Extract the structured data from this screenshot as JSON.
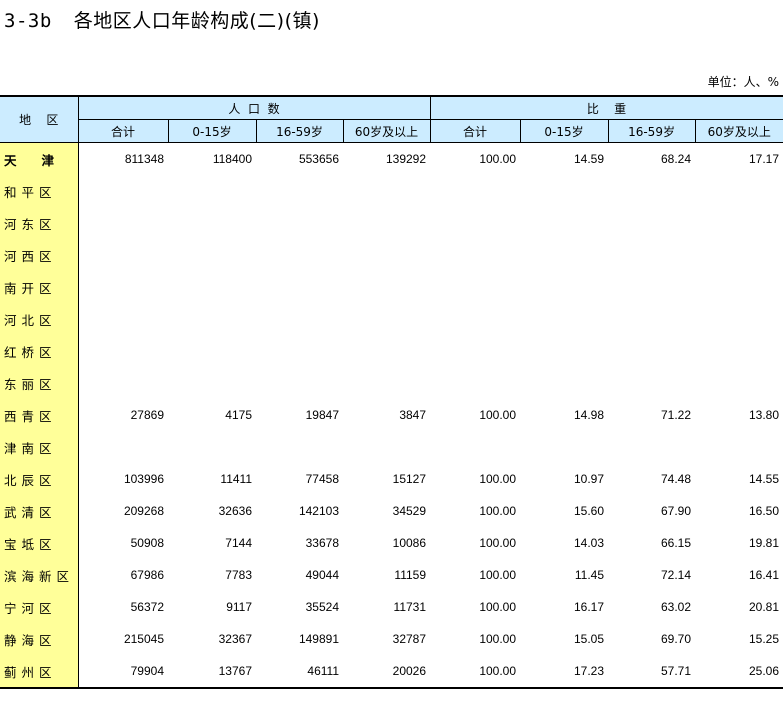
{
  "title": {
    "code": "3-3b",
    "text": "各地区人口年龄构成(二)(镇)"
  },
  "unit": "单位：人、%",
  "header": {
    "region": "地    区",
    "group_population": "人  口  数",
    "group_ratio": "比    重",
    "columns": [
      "合计",
      "0-15岁",
      "16-59岁",
      "60岁及以上",
      "合计",
      "0-15岁",
      "16-59岁",
      "60岁及以上"
    ]
  },
  "rows": [
    {
      "region": "天津",
      "values": [
        "811348",
        "118400",
        "553656",
        "139292",
        "100.00",
        "14.59",
        "68.24",
        "17.17"
      ]
    },
    {
      "region": "和平区",
      "values": [
        "",
        "",
        "",
        "",
        "",
        "",
        "",
        ""
      ]
    },
    {
      "region": "河东区",
      "values": [
        "",
        "",
        "",
        "",
        "",
        "",
        "",
        ""
      ]
    },
    {
      "region": "河西区",
      "values": [
        "",
        "",
        "",
        "",
        "",
        "",
        "",
        ""
      ]
    },
    {
      "region": "南开区",
      "values": [
        "",
        "",
        "",
        "",
        "",
        "",
        "",
        ""
      ]
    },
    {
      "region": "河北区",
      "values": [
        "",
        "",
        "",
        "",
        "",
        "",
        "",
        ""
      ]
    },
    {
      "region": "红桥区",
      "values": [
        "",
        "",
        "",
        "",
        "",
        "",
        "",
        ""
      ]
    },
    {
      "region": "东丽区",
      "values": [
        "",
        "",
        "",
        "",
        "",
        "",
        "",
        ""
      ]
    },
    {
      "region": "西青区",
      "values": [
        "27869",
        "4175",
        "19847",
        "3847",
        "100.00",
        "14.98",
        "71.22",
        "13.80"
      ]
    },
    {
      "region": "津南区",
      "values": [
        "",
        "",
        "",
        "",
        "",
        "",
        "",
        ""
      ]
    },
    {
      "region": "北辰区",
      "values": [
        "103996",
        "11411",
        "77458",
        "15127",
        "100.00",
        "10.97",
        "74.48",
        "14.55"
      ]
    },
    {
      "region": "武清区",
      "values": [
        "209268",
        "32636",
        "142103",
        "34529",
        "100.00",
        "15.60",
        "67.90",
        "16.50"
      ]
    },
    {
      "region": "宝坻区",
      "values": [
        "50908",
        "7144",
        "33678",
        "10086",
        "100.00",
        "14.03",
        "66.15",
        "19.81"
      ]
    },
    {
      "region": "滨海新区",
      "values": [
        "67986",
        "7783",
        "49044",
        "11159",
        "100.00",
        "11.45",
        "72.14",
        "16.41"
      ]
    },
    {
      "region": "宁河区",
      "values": [
        "56372",
        "9117",
        "35524",
        "11731",
        "100.00",
        "16.17",
        "63.02",
        "20.81"
      ]
    },
    {
      "region": "静海区",
      "values": [
        "215045",
        "32367",
        "149891",
        "32787",
        "100.00",
        "15.05",
        "69.70",
        "15.25"
      ]
    },
    {
      "region": "蓟州区",
      "values": [
        "79904",
        "13767",
        "46111",
        "20026",
        "100.00",
        "17.23",
        "57.71",
        "25.06"
      ]
    }
  ]
}
